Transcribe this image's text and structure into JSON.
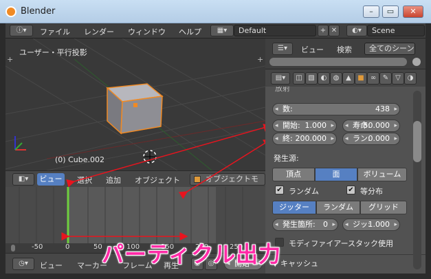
{
  "window": {
    "title": "Blender",
    "minimize": "–",
    "maximize": "▭",
    "close": "✕"
  },
  "topbar": {
    "menus": [
      "ファイル",
      "レンダー",
      "ウィンドウ",
      "ヘルプ"
    ],
    "layout_value": "Default",
    "scene_value": "Scene"
  },
  "viewport": {
    "view_label": "ユーザー・平行投影",
    "object_label": "(0) Cube.002"
  },
  "viewport_header": {
    "view": "ビュー",
    "select": "選択",
    "add": "追加",
    "object": "オブジェクト",
    "mode": "オブジェクトモー"
  },
  "timeline": {
    "ruler_ticks": [
      "-50",
      "0",
      "50",
      "100",
      "150",
      "200",
      "250"
    ],
    "header": {
      "view": "ビュー",
      "marker": "マーカー",
      "frame": "フレーム",
      "playback": "再生",
      "start": "開始"
    }
  },
  "outliner": {
    "view": "ビュー",
    "search": "検索",
    "filter": "全てのシーン"
  },
  "particles": {
    "section_partial": "放射",
    "count_label": "数:",
    "count_value": "438",
    "start_label": "開始:",
    "start_value": "1.000",
    "lifetime_label": "寿命:",
    "lifetime_value": "50.000",
    "end_label": "終:",
    "end_value": "200.000",
    "random_label": "ラン:",
    "random_value": "0.000",
    "emit_from_label": "発生源:",
    "emit_from_options": [
      "頂点",
      "面",
      "ボリューム"
    ],
    "emit_from_selected": "面",
    "random_check": "ランダム",
    "even_check": "等分布",
    "distribution_options": [
      "ジッター",
      "ランダム",
      "グリッド"
    ],
    "distribution_selected": "ジッター",
    "particles_per_face_label": "発生箇所:",
    "particles_per_face_value": "0",
    "jitter_label": "ジッ:",
    "jitter_value": "1.000",
    "modifier_stack_label": "モディファイアースタック使用",
    "cache_label": "キャッシュ"
  },
  "caption": "パーティクル出力",
  "colors": {
    "accent": "#5680c2",
    "annotation": "#ff2aa6",
    "arrow": "#e8141e",
    "selection": "#f08a24"
  }
}
